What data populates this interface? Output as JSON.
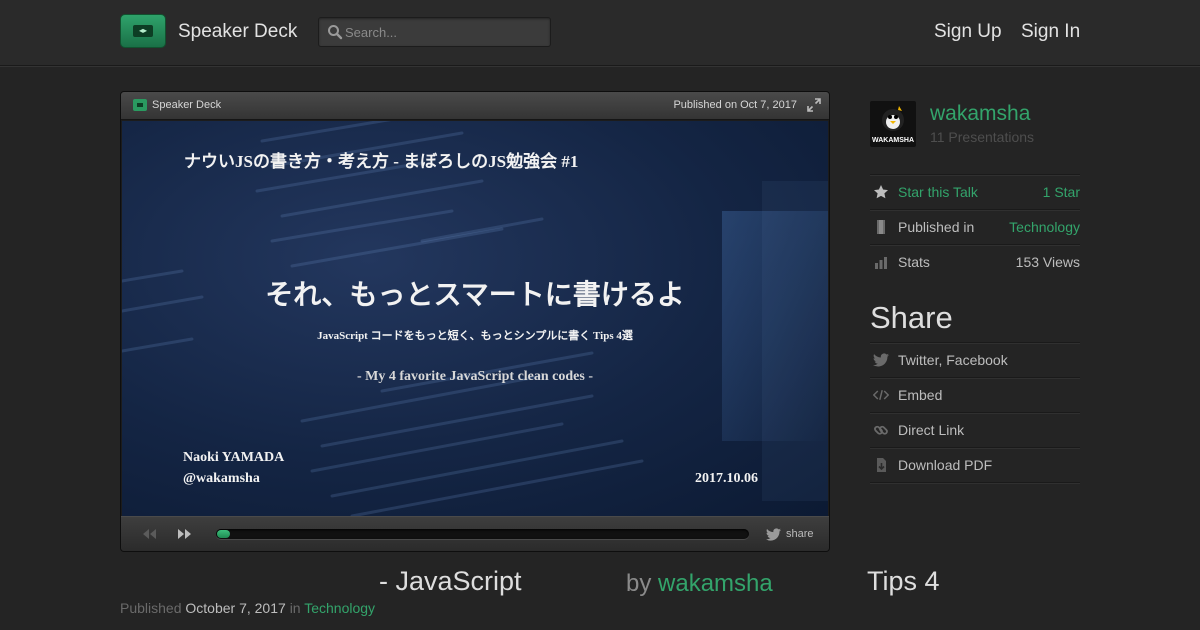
{
  "header": {
    "brand": "Speaker Deck",
    "search_placeholder": "Search...",
    "sign_up": "Sign Up",
    "sign_in": "Sign In"
  },
  "player": {
    "brand": "Speaker Deck",
    "published": "Published on Oct 7, 2017",
    "share_label": "share",
    "progress": 0.025,
    "slide": {
      "subtitle_top": "ナウいJSの書き方・考え方 - まぼろしのJS勉強会 #1",
      "title": "それ、もっとスマートに書けるよ",
      "description": "JavaScript コードをもっと短く、もっとシンプルに書く Tips 4選",
      "english": "- My 4 favorite JavaScript clean codes -",
      "author": "Naoki YAMADA",
      "handle": "@wakamsha",
      "date": "2017.10.06"
    }
  },
  "sidebar": {
    "username": "wakamsha",
    "presentations": "11 Presentations",
    "avatar_text": "WAKAMSHA",
    "rows": [
      {
        "icon": "star-icon",
        "label": "Star this Talk",
        "value": "1 Star"
      },
      {
        "icon": "bookmark-icon",
        "label": "Published in",
        "value": "Technology"
      },
      {
        "icon": "bar-chart-icon",
        "label": "Stats",
        "value": "153 Views"
      }
    ],
    "share_title": "Share",
    "share_rows": [
      {
        "icon": "twitter-bird-icon",
        "label": "Twitter, Facebook"
      },
      {
        "icon": "code-icon",
        "label": "Embed"
      },
      {
        "icon": "link-icon",
        "label": "Direct Link"
      },
      {
        "icon": "download-icon",
        "label": "Download PDF"
      }
    ]
  },
  "talk": {
    "title_a": "- JavaScript",
    "title_b": "Tips 4",
    "by": "by",
    "author": "wakamsha",
    "published_prefix": "Published",
    "published_date": "October 7, 2017",
    "in": "in",
    "category": "Technology"
  },
  "colors": {
    "accent": "#33a46b",
    "background": "#242424",
    "slide_bg": "#142544"
  }
}
